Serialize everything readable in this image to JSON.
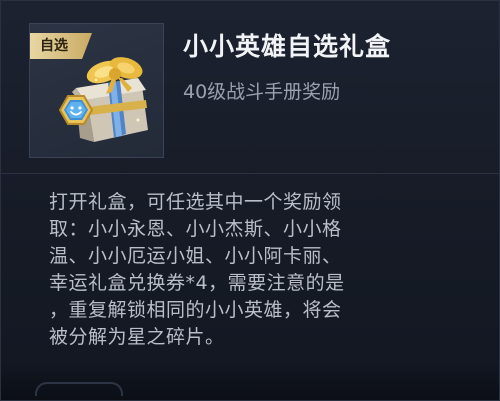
{
  "item": {
    "tag": "自选",
    "title": "小小英雄自选礼盒",
    "subtitle": "40级战斗手册奖励",
    "icon": "gift-box-icon"
  },
  "description": {
    "lines": [
      "打开礼盒，可任选其中一个奖励领",
      "取：小小永恩、小小杰斯、小小格",
      "温、小小厄运小姐、小小阿卡丽、",
      "幸运礼盒兑换券*4，需要注意的是",
      "，重复解锁相同的小小英雄，将会",
      "被分解为星之碎片。"
    ]
  },
  "colors": {
    "tag_gold": "#d9bd7a",
    "title": "#f2f3f6",
    "subtitle": "#9aa1ae",
    "body": "#b9bec8",
    "panel": "#1c2230"
  }
}
